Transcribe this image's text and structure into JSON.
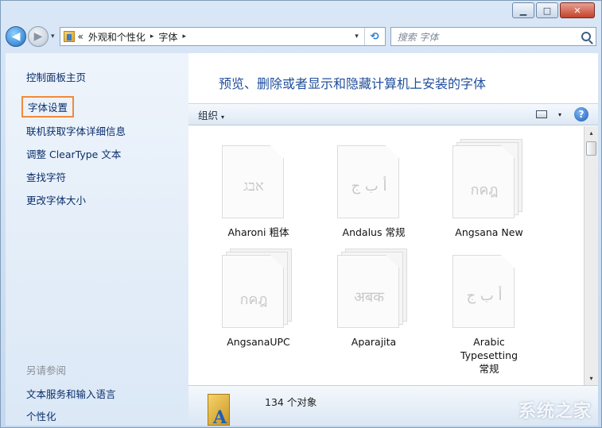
{
  "window": {
    "minimize_glyph": "▁",
    "maximize_glyph": "□",
    "close_glyph": "✕"
  },
  "navbar": {
    "back_glyph": "◀",
    "forward_glyph": "▶",
    "history_glyph": "▾",
    "breadcrumbs": [
      "«",
      "外观和个性化",
      "字体"
    ],
    "crumb_separator": "▸",
    "address_dropdown_glyph": "▾",
    "refresh_glyph": "⟲",
    "search_placeholder": "搜索 字体"
  },
  "sidebar": {
    "home": "控制面板主页",
    "items": [
      {
        "label": "字体设置",
        "selected": true
      },
      {
        "label": "联机获取字体详细信息",
        "selected": false
      },
      {
        "label": "调整 ClearType 文本",
        "selected": false
      },
      {
        "label": "查找字符",
        "selected": false
      },
      {
        "label": "更改字体大小",
        "selected": false
      }
    ],
    "see_also_title": "另请参阅",
    "see_also": [
      "文本服务和输入语言",
      "个性化"
    ]
  },
  "main": {
    "title": "预览、删除或者显示和隐藏计算机上安装的字体",
    "toolbar": {
      "organize": "组织",
      "organize_arrow": "▾",
      "view_arrow": "▾",
      "help_glyph": "?"
    },
    "fonts": [
      {
        "name": "Aharoni 粗体",
        "sample": "אבג",
        "stacked": false
      },
      {
        "name": "Andalus 常规",
        "sample": "أ ب ج",
        "stacked": false
      },
      {
        "name": "Angsana New",
        "sample": "กคฎ",
        "stacked": true
      },
      {
        "name": "AngsanaUPC",
        "sample": "กคฎ",
        "stacked": true
      },
      {
        "name": "Aparajita",
        "sample": "अबक",
        "stacked": true
      },
      {
        "name": "Arabic Typesetting 常规",
        "sample": "أ ب ج",
        "stacked": false
      }
    ],
    "scroll": {
      "up_glyph": "▴",
      "down_glyph": "▾"
    },
    "status": "134 个对象",
    "watermark": "系统之家"
  },
  "colors": {
    "title_blue": "#1f4e9b",
    "link_blue": "#0a2e6b",
    "selection_orange": "#f08a3c"
  }
}
